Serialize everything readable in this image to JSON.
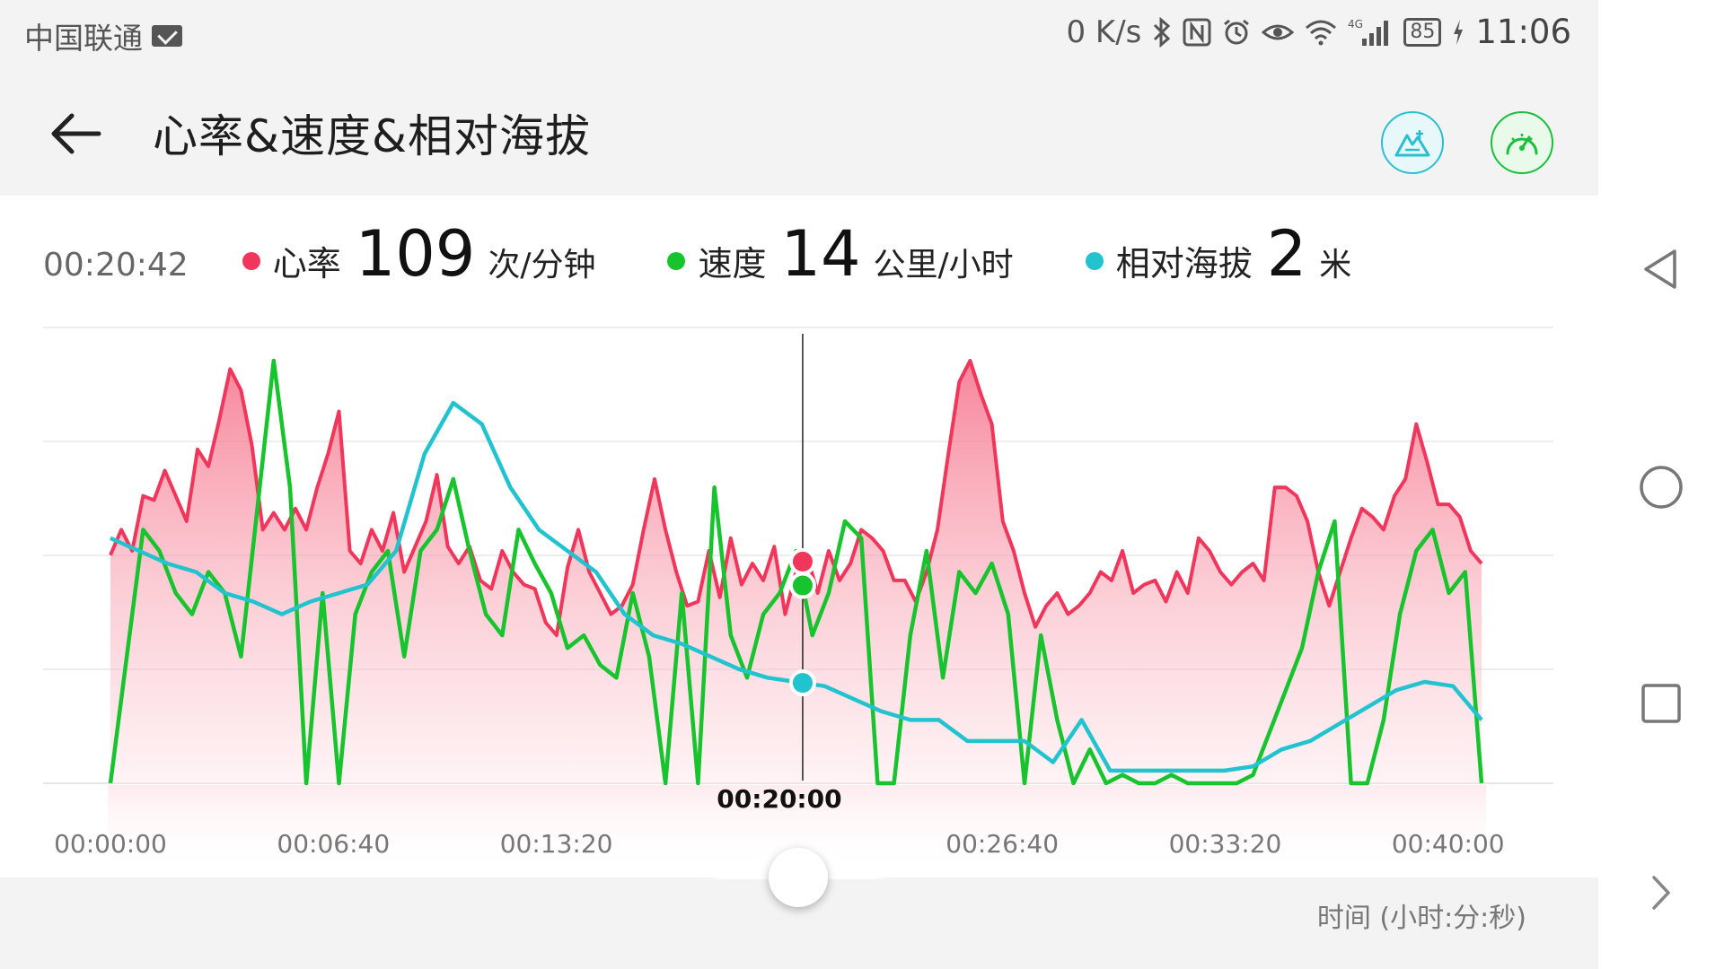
{
  "status": {
    "carrier": "中国联通",
    "net_speed": "0 K/s",
    "network_type": "4G",
    "battery": "85",
    "time": "11:06",
    "icons": [
      "mail-icon",
      "bluetooth-icon",
      "nfc-icon",
      "alarm-icon",
      "eye-icon",
      "wifi-icon",
      "signal-icon",
      "battery-icon",
      "charging-icon"
    ]
  },
  "header": {
    "title": "心率&速度&相对海拔",
    "buttons": [
      "terrain-icon",
      "speedometer-icon"
    ]
  },
  "readout": {
    "time": "00:20:42",
    "heart_rate": {
      "label": "心率",
      "value": "109",
      "unit": "次/分钟",
      "color": "#f0365a"
    },
    "speed": {
      "label": "速度",
      "value": "14",
      "unit": "公里/小时",
      "color": "#18c42e"
    },
    "altitude": {
      "label": "相对海拔",
      "value": "2",
      "unit": "米",
      "color": "#22c3cf"
    }
  },
  "chart": {
    "cursor_label": "00:20:00",
    "x_axis_title": "时间 (小时:分:秒)"
  },
  "chart_data": {
    "type": "line",
    "title": "",
    "xlabel": "时间 (小时:分:秒)",
    "x_ticks": [
      "00:00:00",
      "00:06:40",
      "00:13:20",
      "00:20:00",
      "00:26:40",
      "00:33:20",
      "00:40:00"
    ],
    "x_seconds": [
      0,
      60,
      120,
      180,
      240,
      300,
      360,
      420,
      480,
      540,
      600,
      660,
      720,
      780,
      840,
      900,
      960,
      1020,
      1080,
      1140,
      1200,
      1260,
      1320,
      1380,
      1440,
      1500,
      1560,
      1620,
      1680,
      1740,
      1800,
      1860,
      1920,
      1980,
      2040,
      2100,
      2160,
      2220,
      2280,
      2340,
      2400,
      2460
    ],
    "cursor_seconds": 1242,
    "grid": true,
    "legend": "top",
    "series": [
      {
        "name": "心率",
        "color": "#f0365a",
        "unit": "次/分钟",
        "values": [
          0.54,
          0.6,
          0.55,
          0.68,
          0.67,
          0.74,
          0.68,
          0.62,
          0.79,
          0.75,
          0.86,
          0.98,
          0.93,
          0.8,
          0.6,
          0.64,
          0.6,
          0.65,
          0.6,
          0.7,
          0.78,
          0.88,
          0.55,
          0.52,
          0.6,
          0.55,
          0.64,
          0.5,
          0.56,
          0.62,
          0.73,
          0.56,
          0.52,
          0.56,
          0.48,
          0.46,
          0.55,
          0.5,
          0.47,
          0.46,
          0.38,
          0.35,
          0.51,
          0.6,
          0.5,
          0.45,
          0.4,
          0.42,
          0.47,
          0.6,
          0.72,
          0.6,
          0.5,
          0.42,
          0.43,
          0.55,
          0.44,
          0.58,
          0.47,
          0.52,
          0.48,
          0.56,
          0.4,
          0.5,
          0.54,
          0.45,
          0.55,
          0.48,
          0.52,
          0.6,
          0.58,
          0.55,
          0.48,
          0.48,
          0.43,
          0.5,
          0.6,
          0.78,
          0.95,
          1.0,
          0.92,
          0.85,
          0.62,
          0.55,
          0.45,
          0.37,
          0.42,
          0.45,
          0.4,
          0.42,
          0.45,
          0.5,
          0.48,
          0.55,
          0.45,
          0.47,
          0.48,
          0.43,
          0.5,
          0.45,
          0.58,
          0.55,
          0.5,
          0.47,
          0.5,
          0.52,
          0.48,
          0.7,
          0.7,
          0.68,
          0.62,
          0.5,
          0.42,
          0.5,
          0.58,
          0.65,
          0.63,
          0.6,
          0.68,
          0.72,
          0.85,
          0.76,
          0.66,
          0.66,
          0.63,
          0.55,
          0.52
        ]
      },
      {
        "name": "速度",
        "color": "#18c42e",
        "unit": "公里/小时",
        "values": [
          0.0,
          0.3,
          0.6,
          0.55,
          0.45,
          0.4,
          0.5,
          0.45,
          0.3,
          0.65,
          1.0,
          0.7,
          0.0,
          0.45,
          0.0,
          0.4,
          0.5,
          0.55,
          0.3,
          0.55,
          0.6,
          0.72,
          0.55,
          0.4,
          0.35,
          0.6,
          0.52,
          0.45,
          0.32,
          0.35,
          0.28,
          0.25,
          0.45,
          0.3,
          0.0,
          0.45,
          0.0,
          0.7,
          0.35,
          0.25,
          0.4,
          0.45,
          0.55,
          0.35,
          0.45,
          0.62,
          0.58,
          0.0,
          0.0,
          0.35,
          0.55,
          0.25,
          0.5,
          0.45,
          0.52,
          0.4,
          0.0,
          0.35,
          0.15,
          0.0,
          0.08,
          0.0,
          0.02,
          0.0,
          0.0,
          0.02,
          0.0,
          0.0,
          0.0,
          0.0,
          0.02,
          0.12,
          0.22,
          0.32,
          0.5,
          0.62,
          0.0,
          0.0,
          0.15,
          0.4,
          0.55,
          0.6,
          0.45,
          0.5,
          0.0
        ]
      },
      {
        "name": "相对海拔",
        "color": "#22c3cf",
        "unit": "米",
        "values": [
          0.58,
          0.55,
          0.52,
          0.5,
          0.45,
          0.43,
          0.4,
          0.43,
          0.45,
          0.47,
          0.55,
          0.78,
          0.9,
          0.85,
          0.7,
          0.6,
          0.55,
          0.5,
          0.4,
          0.35,
          0.33,
          0.3,
          0.27,
          0.25,
          0.24,
          0.23,
          0.2,
          0.17,
          0.15,
          0.15,
          0.1,
          0.1,
          0.1,
          0.05,
          0.15,
          0.03,
          0.03,
          0.03,
          0.03,
          0.03,
          0.04,
          0.08,
          0.1,
          0.14,
          0.18,
          0.22,
          0.24,
          0.23,
          0.15
        ]
      }
    ]
  }
}
